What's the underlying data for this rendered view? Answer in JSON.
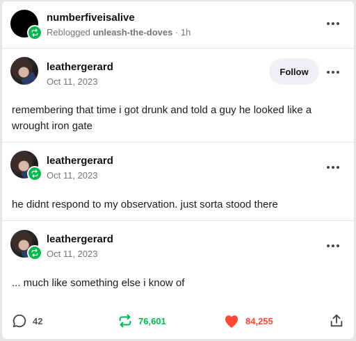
{
  "reblog_header": {
    "username": "numberfiveisalive",
    "reblogged_label": "Reblogged",
    "reblogged_from": "unleash-the-doves",
    "time": "· 1h"
  },
  "posts": [
    {
      "username": "leathergerard",
      "date": "Oct 11, 2023",
      "text": "remembering that time i got drunk and told a guy he looked like a wrought iron gate",
      "follow_label": "Follow"
    },
    {
      "username": "leathergerard",
      "date": "Oct 11, 2023",
      "text": "he didnt respond to my observation. just sorta stood there"
    },
    {
      "username": "leathergerard",
      "date": "Oct 11, 2023",
      "text": "... much like something else i know of"
    }
  ],
  "footer": {
    "comments": "42",
    "reblogs": "76,601",
    "likes": "84,255"
  },
  "colors": {
    "reblog_green": "#00b84f",
    "like_red": "#ff4930"
  },
  "icons": [
    "reblog-icon",
    "more-icon",
    "comment-icon",
    "heart-icon",
    "share-icon"
  ]
}
